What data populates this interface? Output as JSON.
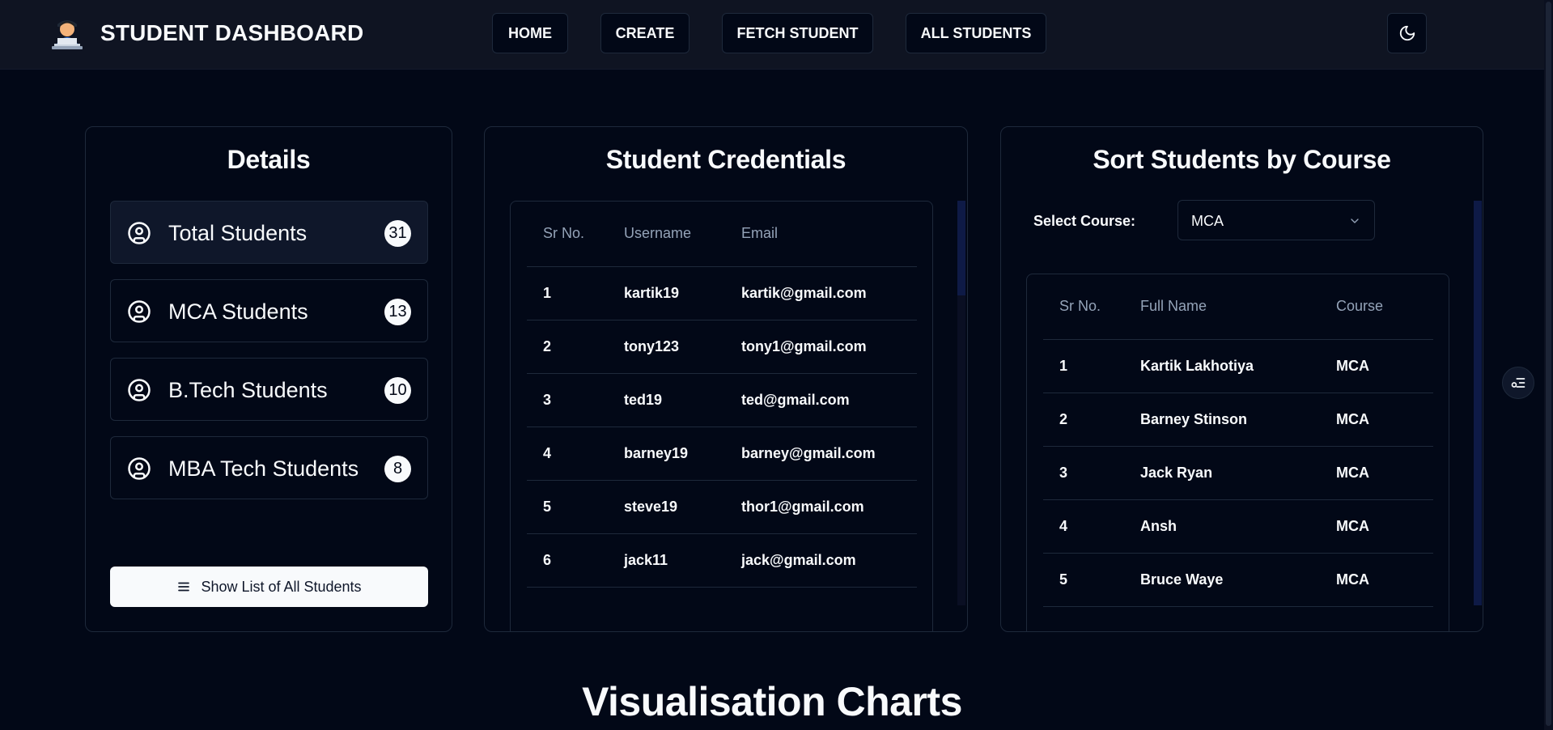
{
  "header": {
    "title": "STUDENT DASHBOARD",
    "logo_icon": "student-with-laptop",
    "nav": [
      {
        "label": "HOME"
      },
      {
        "label": "CREATE"
      },
      {
        "label": "FETCH STUDENT"
      },
      {
        "label": "ALL STUDENTS"
      }
    ],
    "theme_icon": "moon-icon"
  },
  "details": {
    "title": "Details",
    "items": [
      {
        "label": "Total Students",
        "count": "31",
        "icon": "user-circle-icon"
      },
      {
        "label": "MCA Students",
        "count": "13",
        "icon": "user-circle-icon"
      },
      {
        "label": "B.Tech Students",
        "count": "10",
        "icon": "user-circle-icon"
      },
      {
        "label": "MBA Tech Students",
        "count": "8",
        "icon": "user-circle-icon"
      }
    ],
    "show_all_label": "Show List of All Students"
  },
  "credentials": {
    "title": "Student Credentials",
    "columns": [
      "Sr No.",
      "Username",
      "Email"
    ],
    "rows": [
      [
        "1",
        "kartik19",
        "kartik@gmail.com"
      ],
      [
        "2",
        "tony123",
        "tony1@gmail.com"
      ],
      [
        "3",
        "ted19",
        "ted@gmail.com"
      ],
      [
        "4",
        "barney19",
        "barney@gmail.com"
      ],
      [
        "5",
        "steve19",
        "thor1@gmail.com"
      ],
      [
        "6",
        "jack11",
        "jack@gmail.com"
      ]
    ]
  },
  "sort": {
    "title": "Sort Students by Course",
    "select_label": "Select Course:",
    "selected_course": "MCA",
    "columns": [
      "Sr No.",
      "Full Name",
      "Course"
    ],
    "rows": [
      [
        "1",
        "Kartik Lakhotiya",
        "MCA"
      ],
      [
        "2",
        "Barney Stinson",
        "MCA"
      ],
      [
        "3",
        "Jack Ryan",
        "MCA"
      ],
      [
        "4",
        "Ansh",
        "MCA"
      ],
      [
        "5",
        "Bruce Waye",
        "MCA"
      ]
    ]
  },
  "charts_section": {
    "title": "Visualisation Charts"
  },
  "colors": {
    "background": "#020817",
    "header": "#0f1422",
    "border": "#1e293b",
    "muted_text": "#94a3b8",
    "text": "#f8fafc"
  }
}
